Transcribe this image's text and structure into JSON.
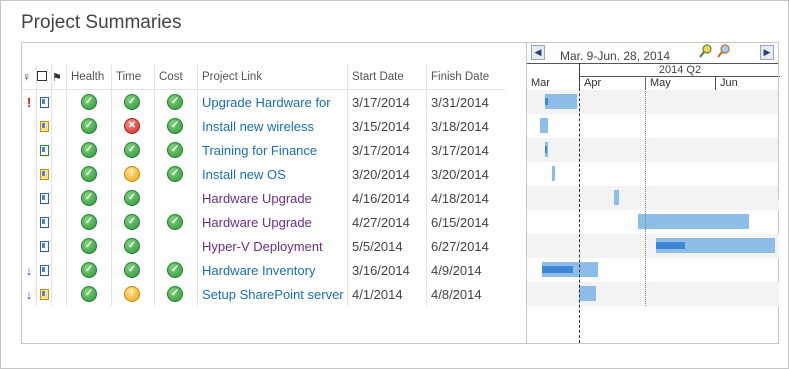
{
  "title": "Project Summaries",
  "columns": {
    "indicator": "",
    "type": "",
    "flag": "",
    "health": "Health",
    "time": "Time",
    "cost": "Cost",
    "project": "Project Link",
    "start": "Start Date",
    "finish": "Finish Date"
  },
  "header_icons": [
    "bulb-icon",
    "checkbox-icon",
    "flag-icon"
  ],
  "rows": [
    {
      "indicator": "!",
      "indicator_icon": "exclamation-icon",
      "type_icon": "project-doc-icon",
      "health": "green",
      "time": "green",
      "cost": "green",
      "name": "Upgrade Hardware for",
      "link_color": "blue",
      "start": "3/17/2014",
      "finish": "3/31/2014",
      "gantt": {
        "start_frac": 0.07,
        "end_frac": 0.2,
        "progress": 0.1
      }
    },
    {
      "indicator": "",
      "indicator_icon": "",
      "type_icon": "project-warning-icon",
      "health": "green",
      "time": "red",
      "cost": "green",
      "name": "Install new wireless",
      "link_color": "blue",
      "start": "3/15/2014",
      "finish": "3/18/2014",
      "gantt": {
        "start_frac": 0.05,
        "end_frac": 0.085,
        "progress": 0
      }
    },
    {
      "indicator": "",
      "indicator_icon": "",
      "type_icon": "project-check-icon",
      "health": "green",
      "time": "green",
      "cost": "green",
      "name": "Training for Finance",
      "link_color": "blue",
      "start": "3/17/2014",
      "finish": "3/17/2014",
      "gantt": {
        "start_frac": 0.07,
        "end_frac": 0.08,
        "progress": 0.7
      }
    },
    {
      "indicator": "",
      "indicator_icon": "",
      "type_icon": "project-warning-icon",
      "health": "green",
      "time": "yellow",
      "cost": "green",
      "name": "Install new OS",
      "link_color": "blue",
      "start": "3/20/2014",
      "finish": "3/20/2014",
      "gantt": {
        "start_frac": 0.1,
        "end_frac": 0.11,
        "progress": 0
      }
    },
    {
      "indicator": "",
      "indicator_icon": "",
      "type_icon": "project-doc-icon",
      "health": "green",
      "time": "green",
      "cost": "",
      "name": "Hardware Upgrade",
      "link_color": "purple",
      "start": "4/16/2014",
      "finish": "4/18/2014",
      "gantt": {
        "start_frac": 0.345,
        "end_frac": 0.365,
        "progress": 0
      }
    },
    {
      "indicator": "",
      "indicator_icon": "",
      "type_icon": "project-doc-icon",
      "health": "green",
      "time": "green",
      "cost": "green",
      "name": "Hardware Upgrade",
      "link_color": "purple",
      "start": "4/27/2014",
      "finish": "6/15/2014",
      "gantt": {
        "start_frac": 0.44,
        "end_frac": 0.88,
        "progress": 0
      }
    },
    {
      "indicator": "",
      "indicator_icon": "",
      "type_icon": "project-doc-icon",
      "health": "green",
      "time": "green",
      "cost": "",
      "name": "Hyper-V Deployment",
      "link_color": "purple",
      "start": "5/5/2014",
      "finish": "6/27/2014",
      "gantt": {
        "start_frac": 0.51,
        "end_frac": 0.985,
        "progress": 0.25
      }
    },
    {
      "indicator": "↓",
      "indicator_icon": "down-arrow-icon",
      "type_icon": "project-doc-icon",
      "health": "green",
      "time": "green",
      "cost": "green",
      "name": "Hardware Inventory",
      "link_color": "blue",
      "start": "3/16/2014",
      "finish": "4/9/2014",
      "gantt": {
        "start_frac": 0.06,
        "end_frac": 0.28,
        "progress": 0.55
      }
    },
    {
      "indicator": "↓",
      "indicator_icon": "down-arrow-icon",
      "type_icon": "project-warning-icon",
      "health": "green",
      "time": "yellow",
      "cost": "green",
      "name": "Setup SharePoint server",
      "link_color": "blue",
      "start": "4/1/2014",
      "finish": "4/8/2014",
      "gantt": {
        "start_frac": 0.205,
        "end_frac": 0.275,
        "progress": 0
      }
    }
  ],
  "gantt": {
    "range_label": "Mar. 9-Jun. 28, 2014",
    "quarter_label": "2014 Q2",
    "months": [
      "Mar",
      "Apr",
      "May",
      "Jun"
    ],
    "prev_icon": "chevron-left-icon",
    "next_icon": "chevron-right-icon",
    "zoom_in_icon": "zoom-in-icon",
    "zoom_out_icon": "zoom-out-icon"
  },
  "colors": {
    "link_blue": "#1a6eb3",
    "link_purple": "#6b2e85",
    "status_green": "#2e9a3a",
    "status_red": "#cf2f22",
    "status_yellow": "#f0a419",
    "gantt_bar": "#8fbde9",
    "gantt_progress": "#3f86d6"
  }
}
